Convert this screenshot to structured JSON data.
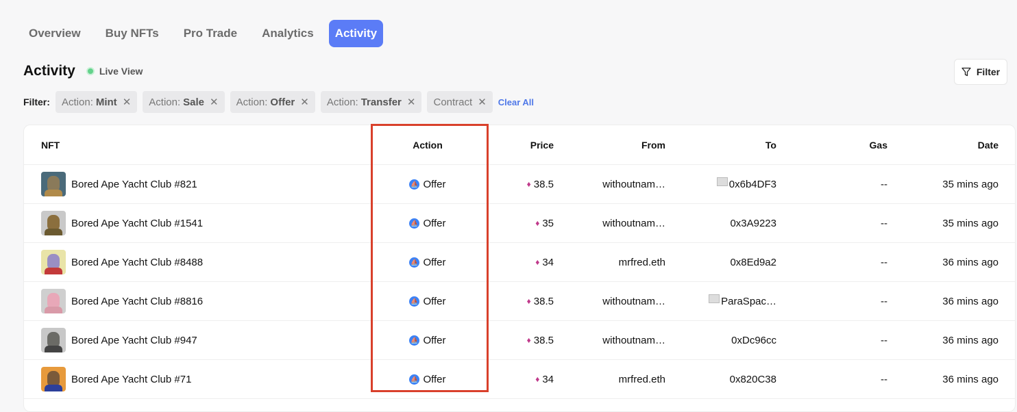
{
  "tabs": [
    {
      "label": "Overview",
      "active": false
    },
    {
      "label": "Buy NFTs",
      "active": false
    },
    {
      "label": "Pro Trade",
      "active": false
    },
    {
      "label": "Analytics",
      "active": false
    },
    {
      "label": "Activity",
      "active": true
    }
  ],
  "page": {
    "title": "Activity",
    "live_label": "Live View",
    "filter_button": "Filter"
  },
  "filters": {
    "label": "Filter:",
    "chips": [
      {
        "prefix": "Action:",
        "value": "Mint"
      },
      {
        "prefix": "Action:",
        "value": "Sale"
      },
      {
        "prefix": "Action:",
        "value": "Offer"
      },
      {
        "prefix": "Action:",
        "value": "Transfer"
      },
      {
        "prefix": "Contract",
        "value": ""
      }
    ],
    "clear_all": "Clear All"
  },
  "table": {
    "headers": {
      "nft": "NFT",
      "action": "Action",
      "price": "Price",
      "from": "From",
      "to": "To",
      "gas": "Gas",
      "date": "Date"
    },
    "rows": [
      {
        "nft": "Bored Ape Yacht Club #821",
        "action": "Offer",
        "price": "38.5",
        "from": "withoutnam…",
        "to": "0x6b4DF3",
        "to_doc": true,
        "gas": "--",
        "date": "35 mins ago",
        "avatar_bg": "#4a6a7a",
        "face": "#8a7a5a",
        "body": "#b08a4a"
      },
      {
        "nft": "Bored Ape Yacht Club #1541",
        "action": "Offer",
        "price": "35",
        "from": "withoutnam…",
        "to": "0x3A9223",
        "to_doc": false,
        "gas": "--",
        "date": "35 mins ago",
        "avatar_bg": "#c9c9c9",
        "face": "#8b6f3e",
        "body": "#6b5a30"
      },
      {
        "nft": "Bored Ape Yacht Club #8488",
        "action": "Offer",
        "price": "34",
        "from": "mrfred.eth",
        "to": "0x8Ed9a2",
        "to_doc": false,
        "gas": "--",
        "date": "36 mins ago",
        "avatar_bg": "#e9e4a8",
        "face": "#9a8fc4",
        "body": "#c33a3a"
      },
      {
        "nft": "Bored Ape Yacht Club #8816",
        "action": "Offer",
        "price": "38.5",
        "from": "withoutnam…",
        "to": "ParaSpac…",
        "to_doc": true,
        "gas": "--",
        "date": "36 mins ago",
        "avatar_bg": "#cfcfcf",
        "face": "#e8a8b8",
        "body": "#d99aa8"
      },
      {
        "nft": "Bored Ape Yacht Club #947",
        "action": "Offer",
        "price": "38.5",
        "from": "withoutnam…",
        "to": "0xDc96cc",
        "to_doc": false,
        "gas": "--",
        "date": "36 mins ago",
        "avatar_bg": "#c8c8c8",
        "face": "#6b6b66",
        "body": "#444"
      },
      {
        "nft": "Bored Ape Yacht Club #71",
        "action": "Offer",
        "price": "34",
        "from": "mrfred.eth",
        "to": "0x820C38",
        "to_doc": false,
        "gas": "--",
        "date": "36 mins ago",
        "avatar_bg": "#e79a3c",
        "face": "#7a5a3a",
        "body": "#2c3f9a"
      }
    ]
  }
}
